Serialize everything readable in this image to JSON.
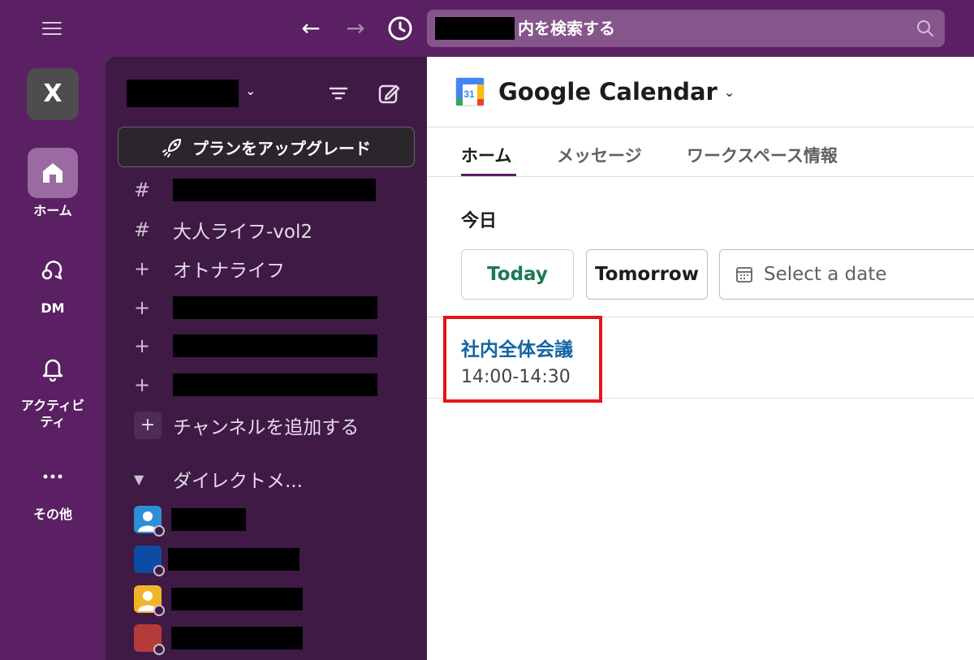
{
  "search": {
    "text": "内を検索する"
  },
  "rail": {
    "workspace_initial": "X",
    "items": [
      {
        "label": "ホーム",
        "icon": "home-icon"
      },
      {
        "label": "DM",
        "icon": "dm-icon"
      },
      {
        "label": "アクティビティ",
        "icon": "bell-icon"
      },
      {
        "label": "その他",
        "icon": "more-icon"
      }
    ]
  },
  "sidebar": {
    "upgrade_label": "プランをアップグレード",
    "channels": [
      {
        "symbol": "#",
        "label": ""
      },
      {
        "symbol": "#",
        "label": "大人ライフ-vol2"
      },
      {
        "symbol": "+",
        "label": "オトナライフ"
      },
      {
        "symbol": "+",
        "label": ""
      },
      {
        "symbol": "+",
        "label": ""
      },
      {
        "symbol": "+",
        "label": ""
      }
    ],
    "add_channel_label": "チャンネルを追加する",
    "dm_section_label": "ダイレクトメ..."
  },
  "main": {
    "app_title": "Google Calendar",
    "calendar_icon_day": "31",
    "tabs": [
      "ホーム",
      "メッセージ",
      "ワークスペース情報"
    ],
    "section_title": "今日",
    "buttons": {
      "today": "Today",
      "tomorrow": "Tomorrow"
    },
    "date_placeholder": "Select a date",
    "event": {
      "title": "社内全体会議",
      "time": "14:00-14:30"
    }
  },
  "colors": {
    "aubergine": "#5a2063",
    "sidebar": "#3e1a45",
    "highlight_red": "#e3151b",
    "link_blue": "#1264a3",
    "today_green": "#1a7a52"
  }
}
